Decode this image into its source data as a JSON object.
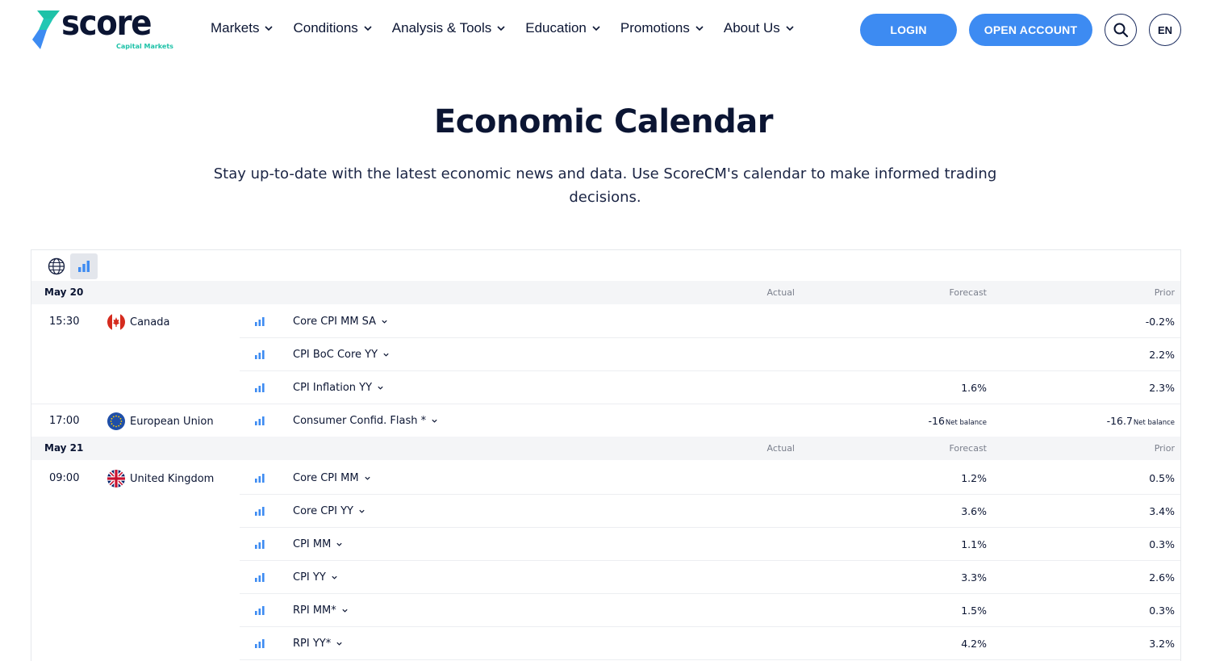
{
  "brand": {
    "name": "score",
    "tagline": "Capital Markets"
  },
  "nav": [
    {
      "label": "Markets"
    },
    {
      "label": "Conditions"
    },
    {
      "label": "Analysis & Tools"
    },
    {
      "label": "Education"
    },
    {
      "label": "Promotions"
    },
    {
      "label": "About Us"
    }
  ],
  "header": {
    "login_label": "LOGIN",
    "open_account_label": "OPEN ACCOUNT",
    "lang_label": "EN"
  },
  "hero": {
    "title": "Economic Calendar",
    "subtitle": "Stay up-to-date with the latest economic news and data. Use ScoreCM's calendar to make informed trading decisions."
  },
  "colors": {
    "accent": "#3d8bf2",
    "navy": "#0b1533",
    "teal": "#1ec2a8"
  },
  "calendar": {
    "columns": {
      "actual": "Actual",
      "forecast": "Forecast",
      "prior": "Prior"
    },
    "days": [
      {
        "date": "May 20",
        "events": [
          {
            "time": "15:30",
            "country": "Canada",
            "flag": "canada-flag-icon",
            "event": "Core CPI MM SA",
            "actual": "",
            "forecast": "",
            "prior": "-0.2%"
          },
          {
            "time": "",
            "country": "",
            "flag": "",
            "event": "CPI BoC Core YY",
            "actual": "",
            "forecast": "",
            "prior": "2.2%"
          },
          {
            "time": "",
            "country": "",
            "flag": "",
            "event": "CPI Inflation YY",
            "actual": "",
            "forecast": "1.6%",
            "prior": "2.3%"
          },
          {
            "time": "17:00",
            "country": "European Union",
            "flag": "eu-flag-icon",
            "event": "Consumer Confid. Flash *",
            "actual": "",
            "forecast": "-16",
            "forecast_unit": "Net balance",
            "prior": "-16.7",
            "prior_unit": "Net balance"
          }
        ]
      },
      {
        "date": "May 21",
        "events": [
          {
            "time": "09:00",
            "country": "United Kingdom",
            "flag": "uk-flag-icon",
            "event": "Core CPI MM",
            "actual": "",
            "forecast": "1.2%",
            "prior": "0.5%"
          },
          {
            "time": "",
            "country": "",
            "flag": "",
            "event": "Core CPI YY",
            "actual": "",
            "forecast": "3.6%",
            "prior": "3.4%"
          },
          {
            "time": "",
            "country": "",
            "flag": "",
            "event": "CPI MM",
            "actual": "",
            "forecast": "1.1%",
            "prior": "0.3%"
          },
          {
            "time": "",
            "country": "",
            "flag": "",
            "event": "CPI YY",
            "actual": "",
            "forecast": "3.3%",
            "prior": "2.6%"
          },
          {
            "time": "",
            "country": "",
            "flag": "",
            "event": "RPI MM*",
            "actual": "",
            "forecast": "1.5%",
            "prior": "0.3%"
          },
          {
            "time": "",
            "country": "",
            "flag": "",
            "event": "RPI YY*",
            "actual": "",
            "forecast": "4.2%",
            "prior": "3.2%"
          }
        ]
      }
    ]
  }
}
